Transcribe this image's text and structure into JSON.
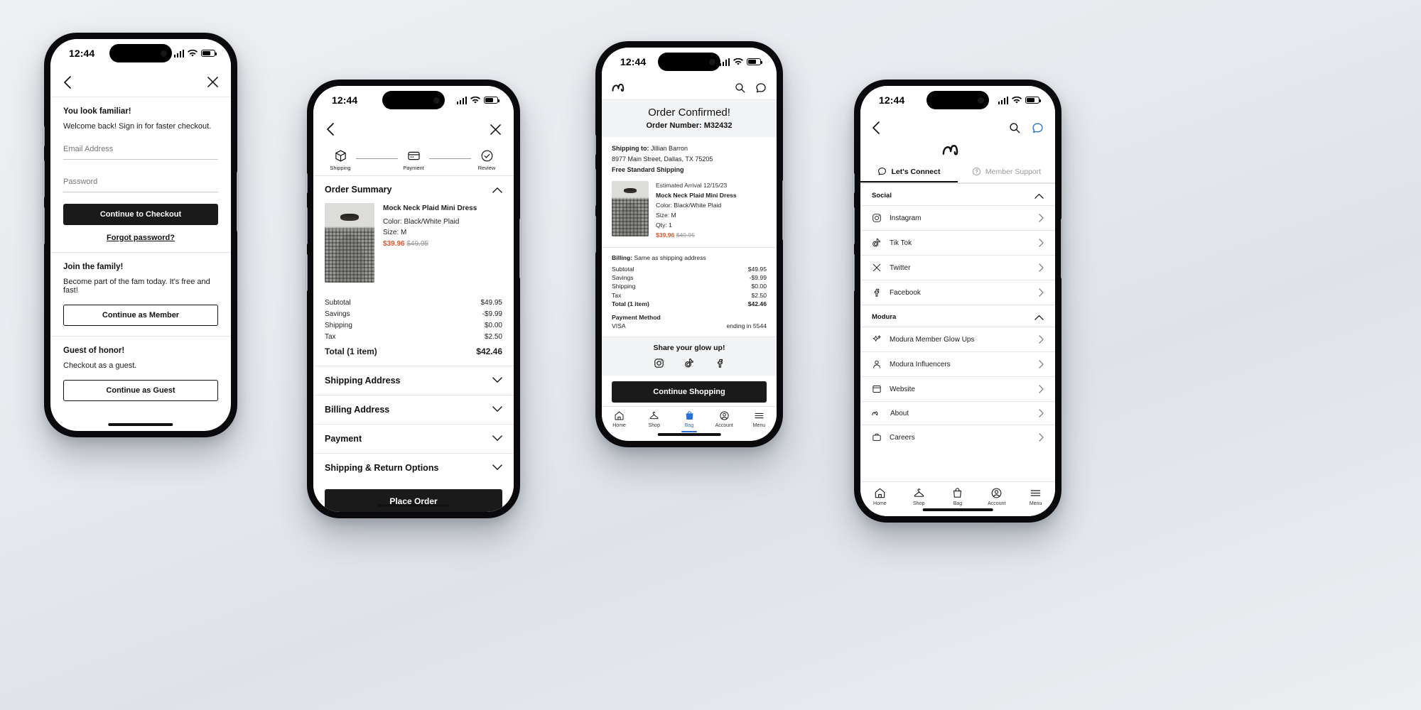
{
  "status_bar": {
    "time": "12:44"
  },
  "colors": {
    "accent_price": "#e0532a",
    "dark": "#1a1a1a",
    "tab_active": "#2b6fd6"
  },
  "phone1": {
    "nav": {
      "back_icon": "chevron-left-icon",
      "close_icon": "close-icon"
    },
    "signin": {
      "heading": "You look familiar!",
      "subtext": "Welcome back! Sign in for faster checkout.",
      "email_placeholder": "Email Address",
      "email_value": "",
      "password_placeholder": "Password",
      "password_value": "",
      "primary_button": "Continue to Checkout",
      "forgot_link": "Forgot password?"
    },
    "member": {
      "heading": "Join the family!",
      "subtext": "Become part of the fam today. It's free and fast!",
      "button": "Continue as Member"
    },
    "guest": {
      "heading": "Guest of honor!",
      "subtext": "Checkout as a guest.",
      "button": "Continue as Guest"
    }
  },
  "phone2": {
    "nav": {
      "back_icon": "chevron-left-icon",
      "close_icon": "close-icon"
    },
    "stepper": [
      {
        "label": "Shipping",
        "icon": "box-icon"
      },
      {
        "label": "Payment",
        "icon": "credit-card-icon"
      },
      {
        "label": "Review",
        "icon": "check-circle-icon"
      }
    ],
    "order_summary": {
      "title": "Order Summary",
      "chevron": "chevron-up-icon",
      "product": {
        "name": "Mock Neck Plaid Mini Dress",
        "color": "Color: Black/White Plaid",
        "size": "Size: M",
        "price_sale": "$39.96",
        "price_original": "$49.95"
      }
    },
    "totals": [
      {
        "label": "Subtotal",
        "value": "$49.95"
      },
      {
        "label": "Savings",
        "value": "-$9.99"
      },
      {
        "label": "Shipping",
        "value": "$0.00"
      },
      {
        "label": "Tax",
        "value": "$2.50"
      }
    ],
    "grand_total": {
      "label": "Total (1 item)",
      "value": "$42.46"
    },
    "accordions": [
      "Shipping Address",
      "Billing Address",
      "Payment",
      "Shipping & Return Options"
    ],
    "place_order_button": "Place Order"
  },
  "phone3": {
    "brand": {
      "logo": "modura-logo",
      "search_icon": "search-icon",
      "chat_icon": "chat-icon"
    },
    "hero": {
      "title": "Order Confirmed!",
      "order_number": "Order Number: M32432"
    },
    "shipping": {
      "to_label": "Shipping to:",
      "to_name": "Jillian Barron",
      "address": "8977 Main Street, Dallas, TX 75205",
      "method": "Free Standard Shipping"
    },
    "product": {
      "eta": "Estimated Arrival 12/15/23",
      "name": "Mock Neck Plaid Mini Dress",
      "color": "Color: Black/White Plaid",
      "size": "Size: M",
      "qty": "Qty: 1",
      "price_sale": "$39.96",
      "price_original": "$49.95"
    },
    "billing_line": {
      "label": "Billing:",
      "value": "Same as shipping address"
    },
    "totals": [
      {
        "label": "Subtotal",
        "value": "$49.95"
      },
      {
        "label": "Savings",
        "value": "-$9.99"
      },
      {
        "label": "Shipping",
        "value": "$0.00"
      },
      {
        "label": "Tax",
        "value": "$2.50"
      }
    ],
    "grand_total": {
      "label": "Total (1 item)",
      "value": "$42.46"
    },
    "payment": {
      "heading": "Payment Method",
      "brand": "VISA",
      "detail": "ending in 5544"
    },
    "share": {
      "heading": "Share your glow up!",
      "icons": [
        "instagram-icon",
        "tiktok-icon",
        "facebook-icon"
      ]
    },
    "cta": "Continue Shopping",
    "tabbar": [
      {
        "label": "Home",
        "icon": "home-icon",
        "active": false
      },
      {
        "label": "Shop",
        "icon": "hanger-icon",
        "active": false
      },
      {
        "label": "Bag",
        "icon": "bag-icon",
        "active": true
      },
      {
        "label": "Account",
        "icon": "account-icon",
        "active": false
      },
      {
        "label": "Menu",
        "icon": "menu-icon",
        "active": false
      }
    ]
  },
  "phone4": {
    "nav": {
      "back_icon": "chevron-left-icon",
      "search_icon": "search-icon",
      "chat_icon": "chat-icon"
    },
    "logo": "modura-logo",
    "tabs": [
      {
        "label": "Let's Connect",
        "icon": "chat-icon",
        "active": true
      },
      {
        "label": "Member Support",
        "icon": "help-circle-icon",
        "active": false
      }
    ],
    "groups": [
      {
        "title": "Social",
        "chevron": "chevron-up-icon",
        "items": [
          {
            "label": "Instagram",
            "icon": "instagram-icon"
          },
          {
            "label": "Tik Tok",
            "icon": "tiktok-icon"
          },
          {
            "label": "Twitter",
            "icon": "x-twitter-icon"
          },
          {
            "label": "Facebook",
            "icon": "facebook-icon"
          }
        ]
      },
      {
        "title": "Modura",
        "chevron": "chevron-up-icon",
        "items": [
          {
            "label": "Modura Member Glow Ups",
            "icon": "sparkle-icon"
          },
          {
            "label": "Modura Influencers",
            "icon": "person-icon"
          },
          {
            "label": "Website",
            "icon": "browser-icon"
          },
          {
            "label": "About",
            "icon": "modura-logo-icon"
          },
          {
            "label": "Careers",
            "icon": "briefcase-icon"
          }
        ]
      }
    ],
    "tabbar": [
      {
        "label": "Home",
        "icon": "home-icon"
      },
      {
        "label": "Shop",
        "icon": "hanger-icon"
      },
      {
        "label": "Bag",
        "icon": "bag-icon"
      },
      {
        "label": "Account",
        "icon": "account-icon"
      },
      {
        "label": "Menu",
        "icon": "menu-icon"
      }
    ]
  }
}
